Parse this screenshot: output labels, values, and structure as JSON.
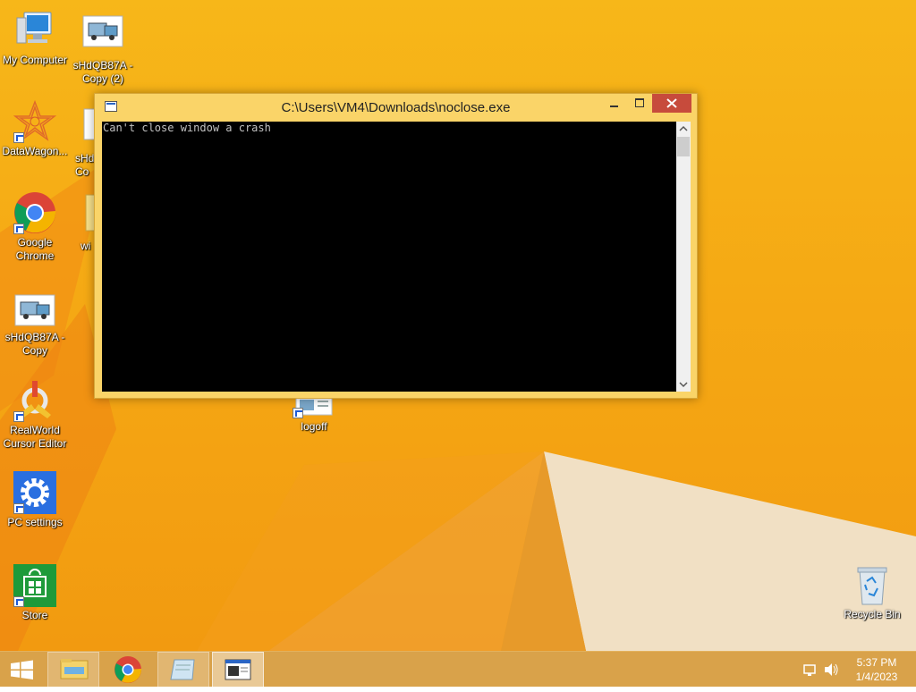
{
  "desktop": {
    "icons": [
      {
        "label": "My Computer"
      },
      {
        "label": "sHdQB87A - Copy (2)"
      },
      {
        "label": "DataWagon..."
      },
      {
        "label": "sHd Co"
      },
      {
        "label": "Google Chrome"
      },
      {
        "label": "wi"
      },
      {
        "label": "sHdQB87A - Copy"
      },
      {
        "label": "RealWorld Cursor Editor"
      },
      {
        "label": "logoff"
      },
      {
        "label": "PC settings"
      },
      {
        "label": "Store"
      },
      {
        "label": "Recycle Bin"
      }
    ]
  },
  "console": {
    "title": "C:\\Users\\VM4\\Downloads\\noclose.exe",
    "output": "Can't close window a crash"
  },
  "taskbar": {
    "apps": [
      "start-icon",
      "file-explorer-icon",
      "chrome-icon",
      "notebook-icon",
      "console-icon"
    ],
    "time": "5:37 PM",
    "date": "1/4/2023"
  },
  "colors": {
    "wallpaper": "#f5a914",
    "close_button": "#c74b3c",
    "titlebar": "#fad468"
  }
}
